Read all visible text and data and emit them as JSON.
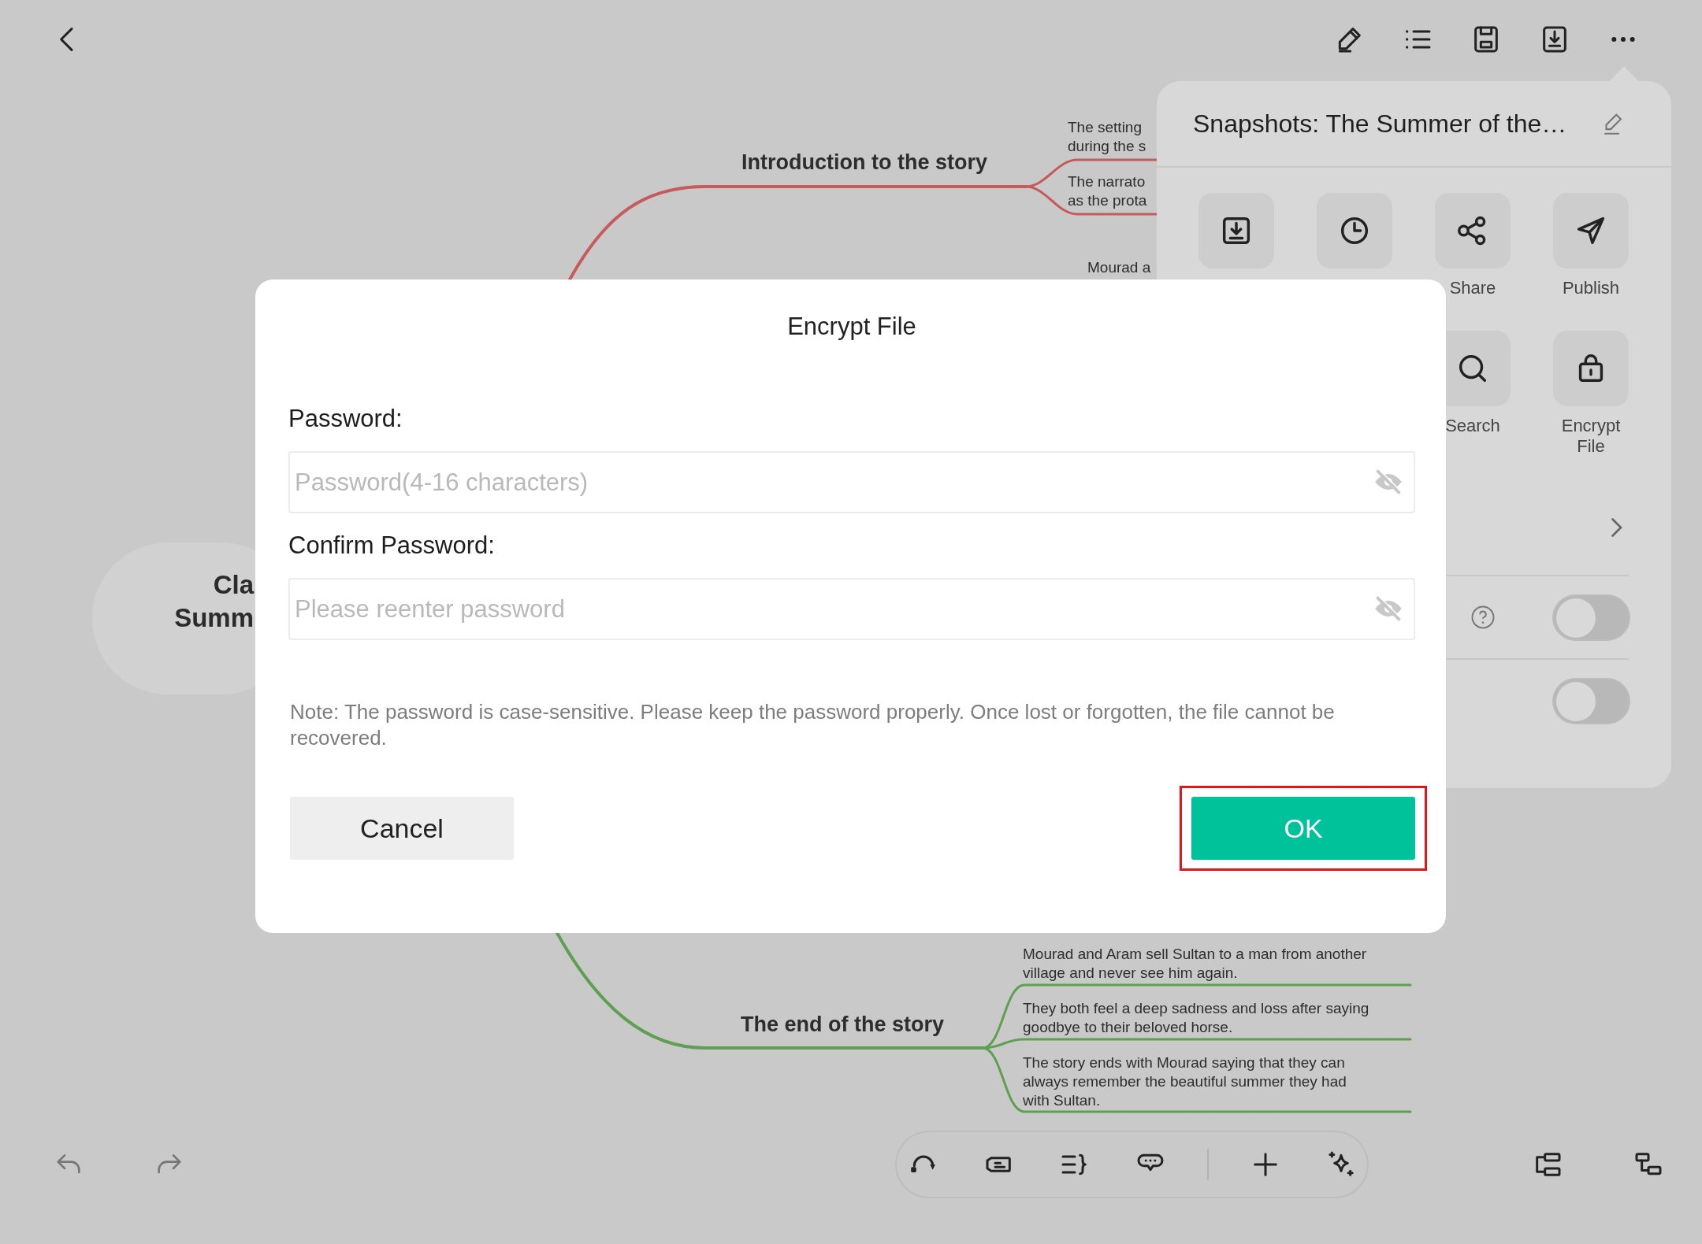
{
  "mind_map": {
    "central_topic": [
      "Cla",
      "Summ"
    ],
    "branches": [
      {
        "title": "Introduction to the story",
        "color": "#c65a5c",
        "children": [
          [
            "The setting",
            "during the s"
          ],
          [
            "The narrato",
            "as the prota"
          ]
        ]
      },
      {
        "title": "The end of the story",
        "color": "#5f9f52",
        "children": [
          [
            "Mourad and Aram sell Sultan to a man from another",
            "village and never see him again."
          ],
          [
            "They both feel a deep sadness and loss after saying",
            "goodbye to their beloved horse."
          ],
          [
            "The story ends with Mourad saying that they can",
            "always remember the beautiful summer they had",
            "with Sultan."
          ]
        ]
      }
    ],
    "partial_topic": "Mourad a"
  },
  "menu_panel": {
    "title": "Snapshots: The Summer of the…",
    "actions": [
      {
        "kind": "export"
      },
      {
        "kind": "history"
      },
      {
        "kind": "share",
        "label": "Share"
      },
      {
        "kind": "publish",
        "label": "Publish"
      },
      {
        "kind": "search",
        "label": "Search"
      },
      {
        "kind": "encrypt",
        "label": "Encrypt\nFile"
      }
    ],
    "toggles": [
      {
        "on": false
      },
      {
        "on": false
      }
    ]
  },
  "dialog": {
    "title": "Encrypt File",
    "fields": [
      {
        "label": "Password:",
        "placeholder": "Password(4-16 characters)"
      },
      {
        "label": "Confirm Password:",
        "placeholder": "Please reenter password"
      }
    ],
    "note": "Note: The password is case-sensitive. Please keep the password properly. Once lost or forgotten, the file cannot be recovered.",
    "buttons": [
      {
        "label": "Cancel",
        "kind": "secondary",
        "highlighted": false
      },
      {
        "label": "OK",
        "kind": "primary",
        "highlighted": true
      }
    ]
  }
}
